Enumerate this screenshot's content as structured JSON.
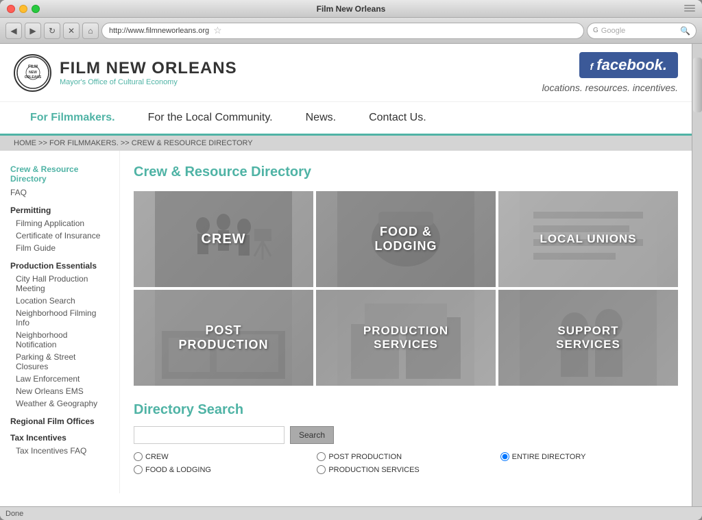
{
  "browser": {
    "title": "Film New Orleans",
    "url": "http://www.filmneworleans.org",
    "search_placeholder": "Google",
    "status": "Done"
  },
  "site": {
    "logo_text": "FILM NEW ORLEANS",
    "logo_subtitle": "Mayor's Office of Cultural Economy",
    "tagline": "locations. resources. incentives.",
    "facebook_label": "facebook.",
    "nav": [
      "For Filmmakers.",
      "For the Local Community.",
      "News.",
      "Contact Us."
    ],
    "breadcrumb": "HOME >> FOR FILMMAKERS. >> CREW & RESOURCE DIRECTORY",
    "sidebar": {
      "active_item": "Crew & Resource Directory",
      "items": [
        {
          "label": "FAQ",
          "type": "link"
        },
        {
          "label": "Permitting",
          "type": "category"
        },
        {
          "label": "Filming Application",
          "type": "sublink"
        },
        {
          "label": "Certificate of Insurance",
          "type": "sublink"
        },
        {
          "label": "Film Guide",
          "type": "sublink"
        },
        {
          "label": "Production Essentials",
          "type": "category"
        },
        {
          "label": "City Hall Production Meeting",
          "type": "sublink"
        },
        {
          "label": "Location Search",
          "type": "sublink"
        },
        {
          "label": "Neighborhood Filming Info",
          "type": "sublink"
        },
        {
          "label": "Neighborhood Notification",
          "type": "sublink"
        },
        {
          "label": "Parking & Street Closures",
          "type": "sublink"
        },
        {
          "label": "Law Enforcement",
          "type": "sublink"
        },
        {
          "label": "New Orleans EMS",
          "type": "sublink"
        },
        {
          "label": "Weather & Geography",
          "type": "sublink"
        },
        {
          "label": "Regional Film Offices",
          "type": "category"
        },
        {
          "label": "Tax Incentives",
          "type": "category"
        },
        {
          "label": "Tax Incentives FAQ",
          "type": "sublink"
        }
      ]
    },
    "main": {
      "page_title": "Crew & Resource Directory",
      "grid_items": [
        {
          "label": "CREW",
          "class": "grid-item-crew"
        },
        {
          "label": "FOOD &\nLODGING",
          "class": "grid-item-food"
        },
        {
          "label": "LOCAL UNIONS",
          "class": "grid-item-unions"
        },
        {
          "label": "POST\nPRODUCTION",
          "class": "grid-item-post"
        },
        {
          "label": "PRODUCTION\nSERVICES",
          "class": "grid-item-production"
        },
        {
          "label": "SUPPORT\nSERVICES",
          "class": "grid-item-support"
        }
      ],
      "directory_search_title": "Directory Search",
      "search_button_label": "Search",
      "radio_options": [
        {
          "label": "CREW",
          "name": "dir",
          "value": "crew"
        },
        {
          "label": "FOOD & LODGING",
          "name": "dir",
          "value": "food"
        },
        {
          "label": "POST PRODUCTION",
          "name": "dir",
          "value": "post"
        },
        {
          "label": "PRODUCTION SERVICES",
          "name": "dir",
          "value": "prodservices"
        },
        {
          "label": "ENTIRE DIRECTORY",
          "name": "dir",
          "value": "entire",
          "checked": true
        }
      ]
    }
  }
}
